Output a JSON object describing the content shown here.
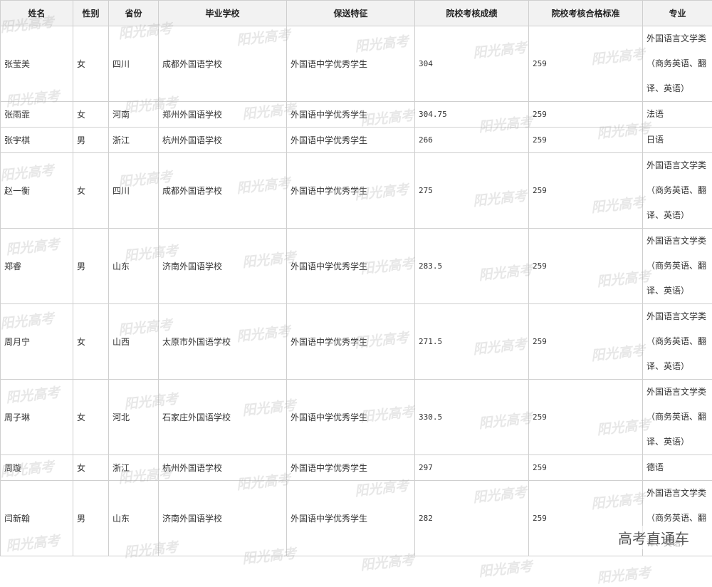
{
  "table": {
    "headers": [
      "姓名",
      "性别",
      "省份",
      "毕业学校",
      "保送特征",
      "院校考核成绩",
      "院校考核合格标准",
      "专业"
    ],
    "rows": [
      {
        "name": "张莹美",
        "gender": "女",
        "province": "四川",
        "school": "成都外国语学校",
        "feature": "外国语中学优秀学生",
        "score": "304",
        "standard": "259",
        "major": [
          "外国语言文学类",
          "（商务英语、翻",
          "译、英语）"
        ]
      },
      {
        "name": "张雨霏",
        "gender": "女",
        "province": "河南",
        "school": "郑州外国语学校",
        "feature": "外国语中学优秀学生",
        "score": "304.75",
        "standard": "259",
        "major": [
          "法语"
        ]
      },
      {
        "name": "张宇棋",
        "gender": "男",
        "province": "浙江",
        "school": "杭州外国语学校",
        "feature": "外国语中学优秀学生",
        "score": "266",
        "standard": "259",
        "major": [
          "日语"
        ]
      },
      {
        "name": "赵一衡",
        "gender": "女",
        "province": "四川",
        "school": "成都外国语学校",
        "feature": "外国语中学优秀学生",
        "score": "275",
        "standard": "259",
        "major": [
          "外国语言文学类",
          "（商务英语、翻",
          "译、英语）"
        ]
      },
      {
        "name": "郑睿",
        "gender": "男",
        "province": "山东",
        "school": "济南外国语学校",
        "feature": "外国语中学优秀学生",
        "score": "283.5",
        "standard": "259",
        "major": [
          "外国语言文学类",
          "（商务英语、翻",
          "译、英语）"
        ]
      },
      {
        "name": "周月宁",
        "gender": "女",
        "province": "山西",
        "school": "太原市外国语学校",
        "feature": "外国语中学优秀学生",
        "score": "271.5",
        "standard": "259",
        "major": [
          "外国语言文学类",
          "（商务英语、翻",
          "译、英语）"
        ]
      },
      {
        "name": "周子琳",
        "gender": "女",
        "province": "河北",
        "school": "石家庄外国语学校",
        "feature": "外国语中学优秀学生",
        "score": "330.5",
        "standard": "259",
        "major": [
          "外国语言文学类",
          "（商务英语、翻",
          "译、英语）"
        ]
      },
      {
        "name": "周璇",
        "gender": "女",
        "province": "浙江",
        "school": "杭州外国语学校",
        "feature": "外国语中学优秀学生",
        "score": "297",
        "standard": "259",
        "major": [
          "德语"
        ]
      },
      {
        "name": "闫新翰",
        "gender": "男",
        "province": "山东",
        "school": "济南外国语学校",
        "feature": "外国语中学优秀学生",
        "score": "282",
        "standard": "259",
        "major": [
          "外国语言文学类",
          "（商务英语、翻",
          "译、英语）"
        ]
      }
    ]
  },
  "watermark_text": "阳光高考",
  "corner_brand": "高考直通车"
}
